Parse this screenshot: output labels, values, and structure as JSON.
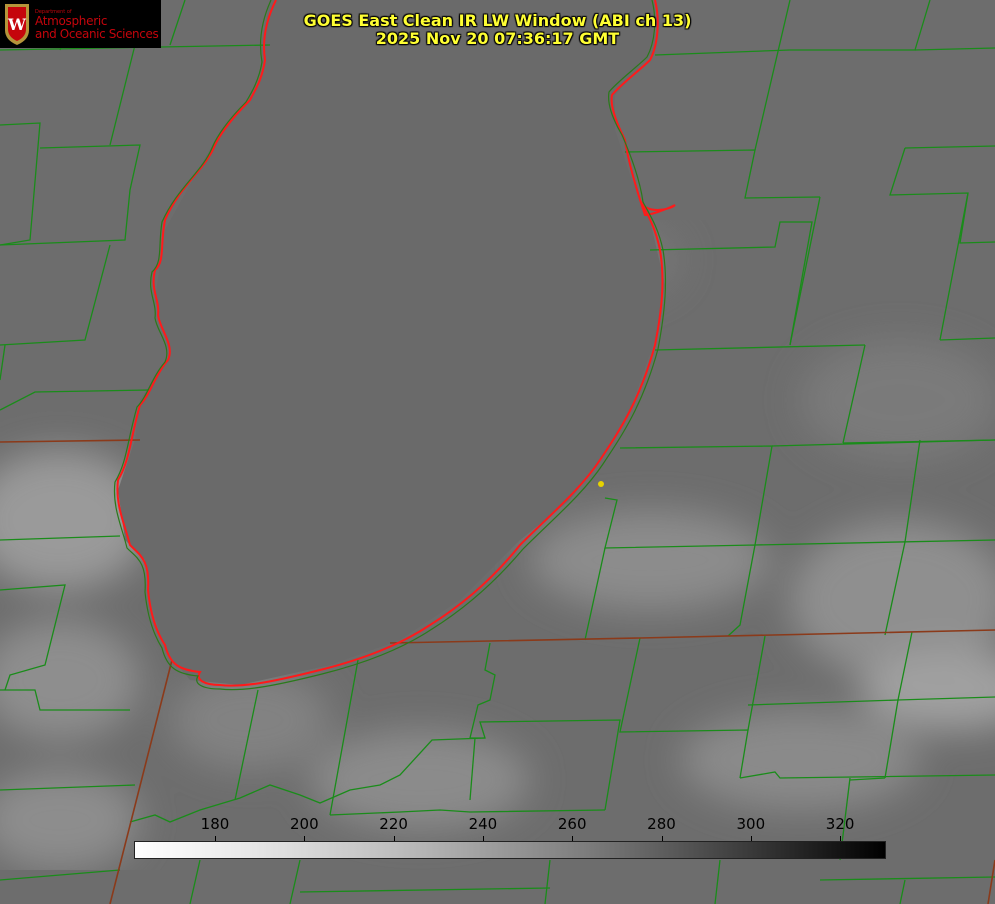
{
  "title": {
    "line1": "GOES East Clean IR LW Window (ABI ch 13)",
    "line2": "2025 Nov 20 07:36:17 GMT"
  },
  "logo": {
    "department": "Department of",
    "line1": "Atmospheric",
    "line2": "and Oceanic Sciences",
    "seal_letter": "W"
  },
  "colorbar": {
    "ticks": [
      "180",
      "200",
      "220",
      "240",
      "260",
      "280",
      "300",
      "320"
    ],
    "min_color": "#ffffff",
    "max_color": "#000000"
  },
  "map": {
    "boundary_color": "#1a8c1a",
    "coast_color": "#ff1a1a",
    "marker_color": "#e6d200"
  }
}
